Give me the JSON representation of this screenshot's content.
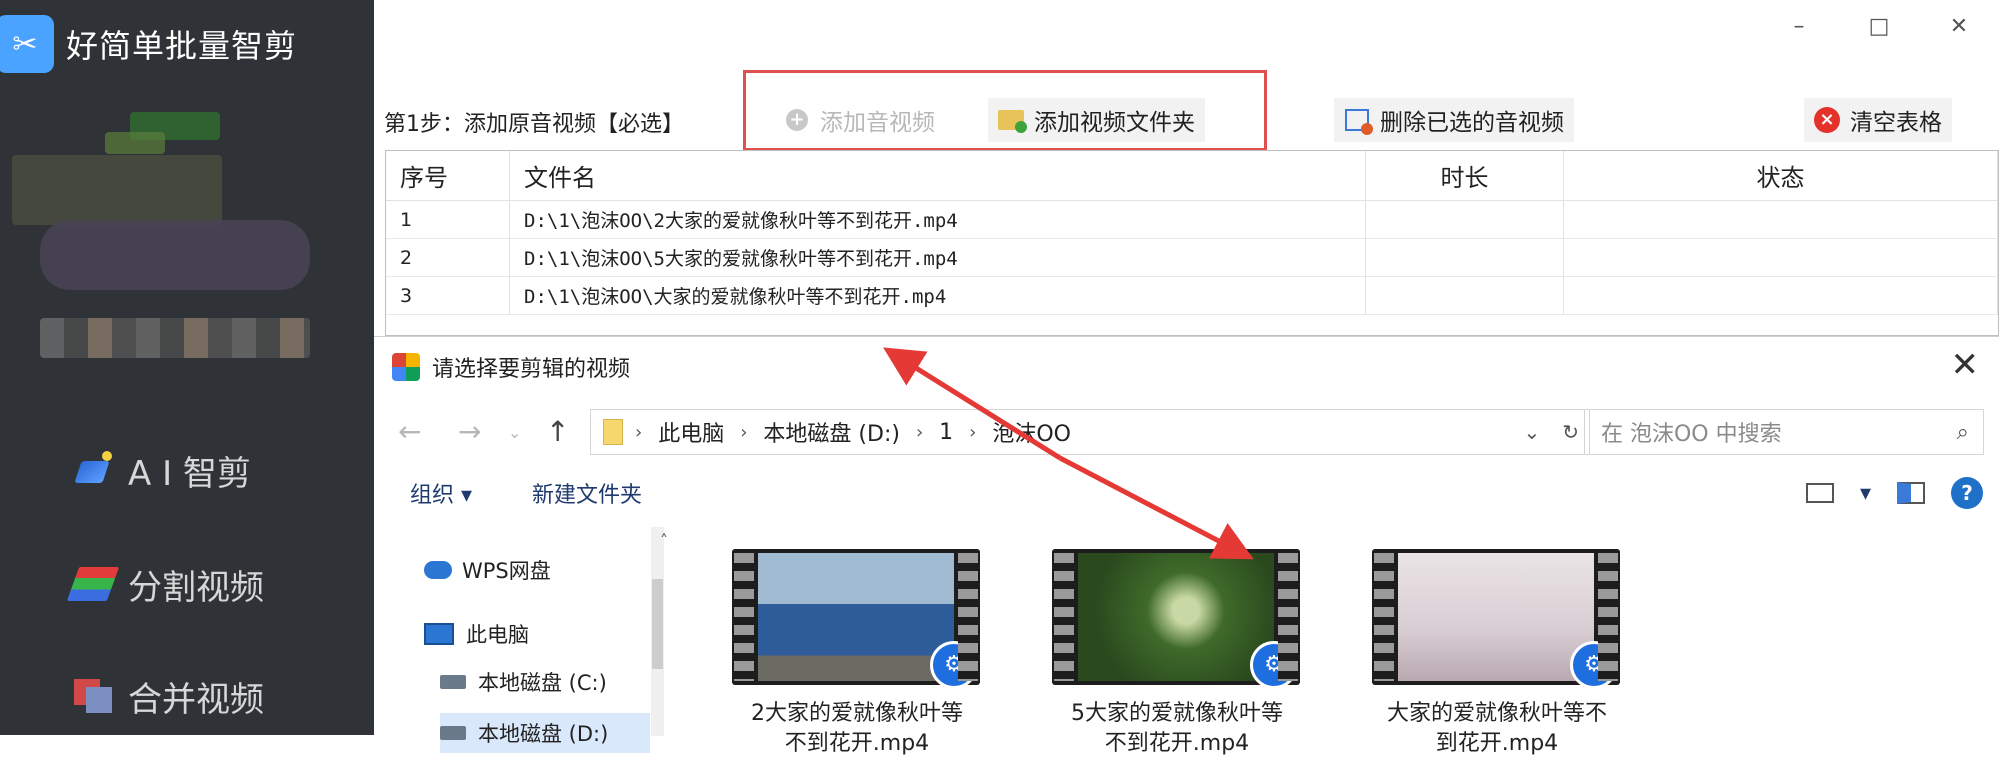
{
  "app": {
    "title": "好简单批量智剪",
    "window_controls": {
      "minimize": "–",
      "maximize": "□",
      "close": "✕"
    }
  },
  "sidebar": {
    "items": [
      {
        "label": "A I 智剪",
        "icon": "ai-cut-icon"
      },
      {
        "label": "分割视频",
        "icon": "split-video-icon"
      },
      {
        "label": "合并视频",
        "icon": "merge-video-icon"
      }
    ]
  },
  "toolbar": {
    "step_label": "第1步：添加原音视频【必选】",
    "add_media": "添加音视频",
    "add_folder": "添加视频文件夹",
    "delete_selected": "删除已选的音视频",
    "clear_table": "清空表格"
  },
  "table": {
    "headers": {
      "no": "序号",
      "name": "文件名",
      "duration": "时长",
      "status": "状态"
    },
    "rows": [
      {
        "no": "1",
        "name": "D:\\1\\泡沫OO\\2大家的爱就像秋叶等不到花开.mp4",
        "duration": "",
        "status": ""
      },
      {
        "no": "2",
        "name": "D:\\1\\泡沫OO\\5大家的爱就像秋叶等不到花开.mp4",
        "duration": "",
        "status": ""
      },
      {
        "no": "3",
        "name": "D:\\1\\泡沫OO\\大家的爱就像秋叶等不到花开.mp4",
        "duration": "",
        "status": ""
      }
    ]
  },
  "dialog": {
    "title": "请选择要剪辑的视频",
    "close": "✕",
    "address": [
      "此电脑",
      "本地磁盘 (D:)",
      "1",
      "泡沫OO"
    ],
    "search_placeholder": "在 泡沫OO 中搜索",
    "commands": {
      "organize": "组织 ▾",
      "new_folder": "新建文件夹"
    },
    "tree": [
      "WPS网盘",
      "此电脑",
      "本地磁盘 (C:)",
      "本地磁盘 (D:)"
    ],
    "files": [
      {
        "line1": "2大家的爱就像秋叶等",
        "line2": "不到花开.mp4"
      },
      {
        "line1": "5大家的爱就像秋叶等",
        "line2": "不到花开.mp4"
      },
      {
        "line1": "大家的爱就像秋叶等不",
        "line2": "到花开.mp4"
      }
    ]
  },
  "colors": {
    "sidebar_bg": "#2f3237",
    "highlight_red": "#e05050",
    "arrow_red": "#e53935",
    "accent_blue": "#1e70c9"
  }
}
